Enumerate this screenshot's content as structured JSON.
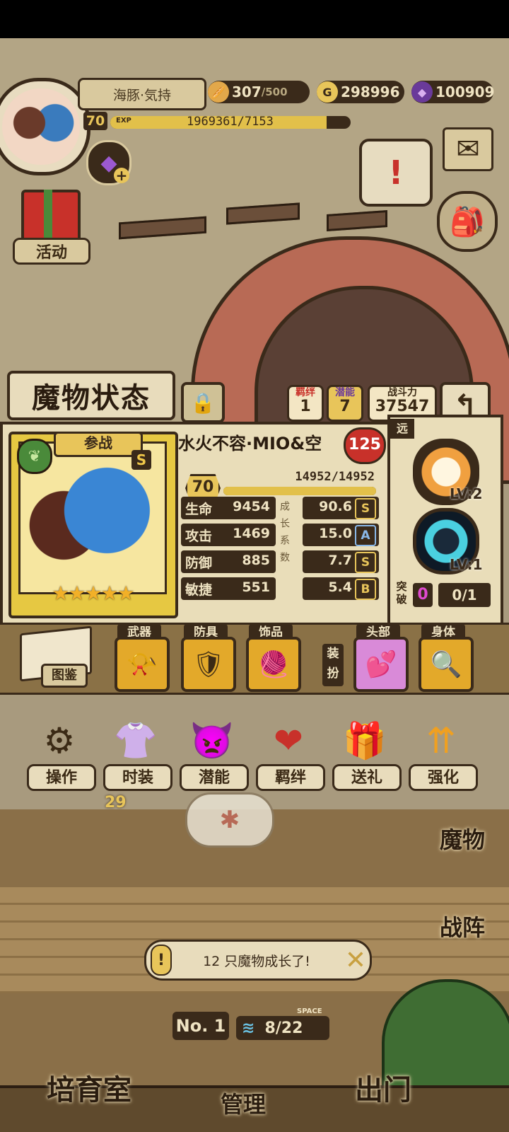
{
  "player": {
    "name": "海豚·気持",
    "level": "70",
    "exp_label": "EXP",
    "exp_text": "1969361/7153",
    "exp_progress": 0.9
  },
  "resources": {
    "stamina": "307",
    "stamina_max": "/500",
    "gold": "298996",
    "gems": "100909",
    "gold_icon": "G"
  },
  "side_buttons": {
    "activity": "活动",
    "monster": "魔物",
    "formation": "战阵"
  },
  "panel": {
    "title": "魔物状态",
    "bond": {
      "label": "羁绊",
      "value": "1"
    },
    "potential": {
      "label": "潜能",
      "value": "7"
    },
    "power": {
      "label": "战斗力",
      "value": "37547"
    }
  },
  "monster": {
    "name": "水火不容·MIO&空",
    "affection": "125",
    "standby": "参战",
    "rank": "S",
    "stars": "★★★★★",
    "level": "70",
    "hp_text": "14952/14952",
    "hp_progress": 1.0,
    "stats": [
      {
        "label": "生命",
        "value": "9454",
        "growth": "90.6",
        "grade": "S"
      },
      {
        "label": "攻击",
        "value": "1469",
        "growth": "15.0",
        "grade": "A"
      },
      {
        "label": "防御",
        "value": "885",
        "growth": "7.7",
        "grade": "S"
      },
      {
        "label": "敏捷",
        "value": "551",
        "growth": "5.4",
        "grade": "B"
      }
    ],
    "growth_note": "成长系数"
  },
  "skills": {
    "range": "远",
    "skill1_level": "LV:2",
    "skill2_level": "LV:1",
    "break_label": "突破",
    "break_value": "0",
    "break_progress": "0/1"
  },
  "equipment": {
    "codex": "图鉴",
    "weapon": "武器",
    "armor": "防具",
    "accessory": "饰品",
    "dress": "装扮",
    "head": "头部",
    "body": "身体"
  },
  "menu": [
    {
      "label": "操作"
    },
    {
      "label": "时装"
    },
    {
      "label": "潜能"
    },
    {
      "label": "羁绊"
    },
    {
      "label": "送礼"
    },
    {
      "label": "强化"
    }
  ],
  "room": {
    "level": "29",
    "toast": "12 只魔物成长了!",
    "number": "No. 1",
    "space_label": "SPACE",
    "space": "8/22"
  },
  "bottom": {
    "nursery": "培育室",
    "manage": "管理",
    "exit": "出门"
  },
  "colors": {
    "outline": "#3a2a1a",
    "parchment": "#e8dcbc",
    "gold": "#e8c55a",
    "heart_red": "#c8312a",
    "gem_purple": "#9b59d0"
  }
}
